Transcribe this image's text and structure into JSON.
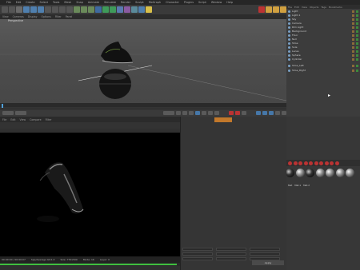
{
  "app": {
    "menu": [
      "File",
      "Edit",
      "Create",
      "Select",
      "Tools",
      "Mesh",
      "Snap",
      "Animate",
      "Simulate",
      "Render",
      "Sculpt",
      "MoGraph",
      "Character",
      "Plugins",
      "Script",
      "Window",
      "Help"
    ]
  },
  "viewport": {
    "menu": [
      "View",
      "Cameras",
      "Display",
      "Options",
      "Filter",
      "Panel"
    ],
    "name": "Perspective"
  },
  "object_manager": {
    "tabs": [
      "File",
      "Edit",
      "View",
      "Objects",
      "Tags",
      "Bookmarks"
    ],
    "items": [
      {
        "label": "Light"
      },
      {
        "label": "Light.1"
      },
      {
        "label": "Sky"
      },
      {
        "label": "Camera"
      },
      {
        "label": "Rim Light"
      },
      {
        "label": "Background"
      },
      {
        "label": "Floor"
      },
      {
        "label": "Null"
      },
      {
        "label": "Shoe"
      },
      {
        "label": "Sole"
      },
      {
        "label": "Laces"
      },
      {
        "label": "Sphere"
      },
      {
        "label": "Cylinder"
      },
      {
        "label": "Shoe_Left"
      },
      {
        "label": "Shoe_Right"
      }
    ]
  },
  "render_view": {
    "menu": [
      "File",
      "Edit",
      "View",
      "Compare",
      "Filter"
    ],
    "status": [
      "00:00:00 / 00:00:07",
      "Spp/Average 9/11.3",
      "Size: 770x500",
      "Mode: 16",
      "Layer: 0"
    ],
    "progress": 0.98
  },
  "materials": {
    "labels": [
      "Mat",
      "Mat.1",
      "Mat.2"
    ],
    "count": 7
  },
  "mid_panel": {
    "button": "Apply"
  },
  "colors": {
    "accent_orange": "#c2782b",
    "progress_green": "#3fbf3f",
    "record_red": "#b33333"
  }
}
